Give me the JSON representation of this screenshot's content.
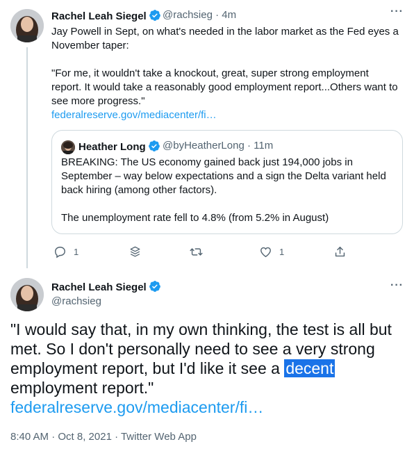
{
  "tweet1": {
    "author_name": "Rachel Leah Siegel",
    "author_handle": "@rachsieg",
    "time": "4m",
    "text": "Jay Powell in Sept, on what's needed in the labor market as the Fed eyes a November taper:\n\n\"For me, it wouldn't take a knockout, great, super strong employment report. It would take a reasonably good employment report...Others want to see more progress.\"",
    "link": "federalreserve.gov/mediacenter/fi…",
    "quote": {
      "author_name": "Heather Long",
      "author_handle": "@byHeatherLong",
      "time": "11m",
      "text": "BREAKING: The US economy gained back just 194,000 jobs in September – way below expectations and a sign the Delta variant held back hiring (among other factors).\n\nThe unemployment rate fell to 4.8% (from 5.2% in August)"
    },
    "actions": {
      "reply_count": "1",
      "like_count": "1"
    }
  },
  "tweet2": {
    "author_name": "Rachel Leah Siegel",
    "author_handle": "@rachsieg",
    "text_before": "\"I would say that, in my own thinking, the test is all but met. So I don't personally need to see a very strong employment report, but I'd like it see a ",
    "text_highlight": "decent ",
    "text_after": "employment report.\"",
    "link": "federalreserve.gov/mediacenter/fi…",
    "footer": "8:40 AM · Oct 8, 2021 · Twitter Web App"
  },
  "colors": {
    "accent": "#1d9bf0",
    "muted": "#536471",
    "border": "#cfd9de",
    "highlight": "#1a73e8"
  },
  "icons": {
    "verified": "verified-badge-icon",
    "reply": "reply-icon",
    "stack": "stack-icon",
    "retweet": "retweet-icon",
    "like": "heart-icon",
    "share": "share-icon",
    "more": "more-icon"
  }
}
